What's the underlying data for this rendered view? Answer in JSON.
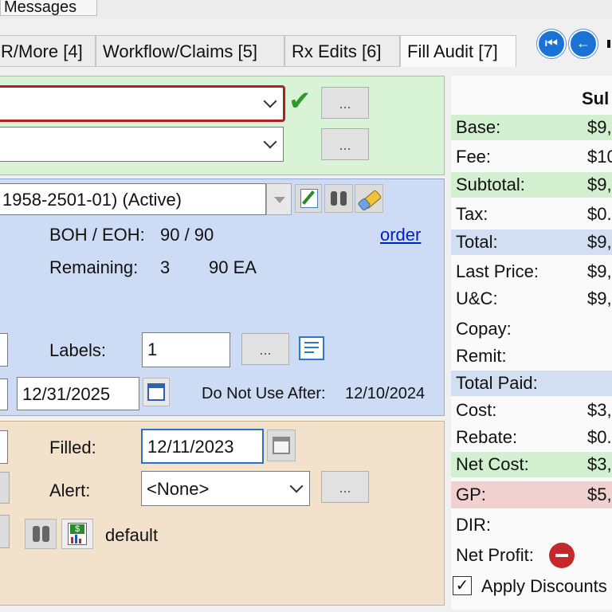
{
  "top_tab": "Messages",
  "tabs": [
    {
      "label": "R/More [4]"
    },
    {
      "label": "Workflow/Claims [5]"
    },
    {
      "label": "Rx Edits [6]"
    },
    {
      "label": "Fill Audit [7]"
    }
  ],
  "green_panel": {
    "more_button": "...",
    "more_button_2": "..."
  },
  "blue_panel": {
    "ndc_value": "1958-2501-01) (Active)",
    "boh_eoh_label": "BOH / EOH:",
    "boh_eoh_value": "90 / 90",
    "order_link": "order",
    "remaining_label": "Remaining:",
    "remaining_value": "3",
    "remaining_qty": "90 EA",
    "labels_label": "Labels:",
    "labels_value": "1",
    "labels_more": "...",
    "expiry_date": "12/31/2025",
    "do_not_use_label": "Do Not Use After:",
    "do_not_use_value": "12/10/2024"
  },
  "tan_panel": {
    "filled_label": "Filled:",
    "filled_value": "12/11/2023",
    "alert_label": "Alert:",
    "alert_value": "<None>",
    "alert_more": "...",
    "default_label": "default"
  },
  "sidebar": {
    "header": "Sul",
    "rows": [
      {
        "k": "Base:",
        "v": "$9,"
      },
      {
        "k": "Fee:",
        "v": "$10"
      },
      {
        "k": "Subtotal:",
        "v": "$9,"
      },
      {
        "k": "Tax:",
        "v": "$0."
      },
      {
        "k": "Total:",
        "v": "$9,"
      },
      {
        "k": "Last Price:",
        "v": "$9,"
      },
      {
        "k": "U&C:",
        "v": "$9,"
      },
      {
        "k": "Copay:",
        "v": ""
      },
      {
        "k": "Remit:",
        "v": ""
      },
      {
        "k": "Total Paid:",
        "v": ""
      },
      {
        "k": "Cost:",
        "v": "$3,"
      },
      {
        "k": "Rebate:",
        "v": "$0."
      },
      {
        "k": "Net Cost:",
        "v": "$3,"
      },
      {
        "k": "GP:",
        "v": "$5,"
      },
      {
        "k": "DIR:",
        "v": ""
      },
      {
        "k": "Net Profit:",
        "v": ""
      }
    ],
    "apply_discounts": "Apply Discounts"
  }
}
